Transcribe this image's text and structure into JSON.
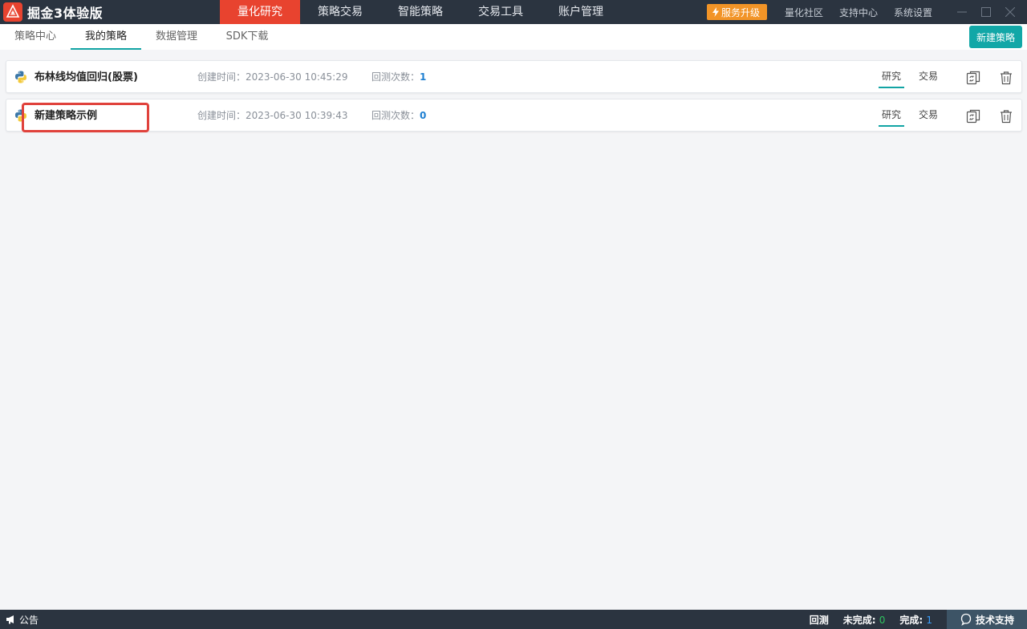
{
  "app": {
    "title": "掘金3体验版",
    "brand_color": "#e8432f"
  },
  "main_nav": [
    {
      "label": "量化研究",
      "active": true
    },
    {
      "label": "策略交易",
      "active": false
    },
    {
      "label": "智能策略",
      "active": false
    },
    {
      "label": "交易工具",
      "active": false
    },
    {
      "label": "账户管理",
      "active": false
    }
  ],
  "top_right": {
    "upgrade_label": "服务升级",
    "links": [
      "量化社区",
      "支持中心",
      "系统设置"
    ]
  },
  "sub_nav": {
    "tabs": [
      {
        "label": "策略中心",
        "active": false
      },
      {
        "label": "我的策略",
        "active": true
      },
      {
        "label": "数据管理",
        "active": false
      },
      {
        "label": "SDK下载",
        "active": false
      }
    ],
    "new_strategy_label": "新建策略"
  },
  "strategies": [
    {
      "name": "布林线均值回归(股票)",
      "created_label": "创建时间：",
      "created_at": "2023-06-30 10:45:29",
      "count_label": "回测次数：",
      "count": "1",
      "tab_research": "研究",
      "tab_trade": "交易"
    },
    {
      "name": "新建策略示例",
      "created_label": "创建时间：",
      "created_at": "2023-06-30 10:39:43",
      "count_label": "回测次数：",
      "count": "0",
      "tab_research": "研究",
      "tab_trade": "交易"
    }
  ],
  "status_bar": {
    "notice_label": "公告",
    "backtest_label": "回测",
    "unfinished_label": "未完成:",
    "unfinished_count": "0",
    "finished_label": "完成:",
    "finished_count": "1",
    "support_label": "技术支持"
  },
  "colors": {
    "topbar": "#2b3440",
    "accent_teal": "#12a7a7",
    "upgrade_orange": "#f29427",
    "highlight_red": "#e0423c"
  }
}
